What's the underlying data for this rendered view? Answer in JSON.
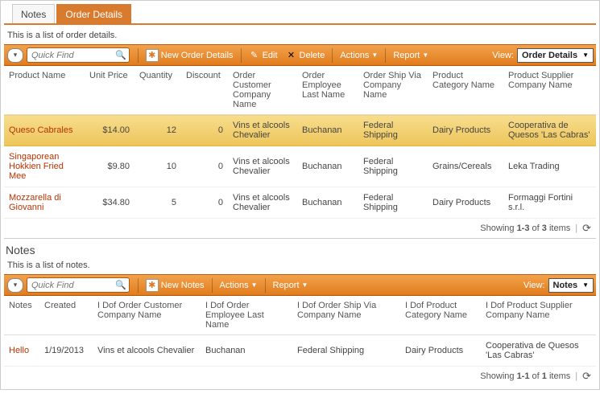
{
  "tabs": {
    "notes": "Notes",
    "order_details": "Order Details",
    "active": "order_details"
  },
  "od": {
    "subtitle": "This is a list of order details.",
    "search_placeholder": "Quick Find",
    "toolbar": {
      "new": "New Order Details",
      "edit": "Edit",
      "delete": "Delete",
      "actions": "Actions",
      "report": "Report",
      "view_label": "View:",
      "view_value": "Order Details"
    },
    "cols": [
      "Product Name",
      "Unit Price",
      "Quantity",
      "Discount",
      "Order Customer Company Name",
      "Order Employee Last Name",
      "Order Ship Via Company Name",
      "Product Category Name",
      "Product Supplier Company Name"
    ],
    "rows": [
      {
        "product": "Queso Cabrales",
        "price": "$14.00",
        "qty": "12",
        "disc": "0",
        "cust": "Vins et alcools Chevalier",
        "emp": "Buchanan",
        "ship": "Federal Shipping",
        "cat": "Dairy Products",
        "sup": "Cooperativa de Quesos 'Las Cabras'",
        "sel": true
      },
      {
        "product": "Singaporean Hokkien Fried Mee",
        "price": "$9.80",
        "qty": "10",
        "disc": "0",
        "cust": "Vins et alcools Chevalier",
        "emp": "Buchanan",
        "ship": "Federal Shipping",
        "cat": "Grains/Cereals",
        "sup": "Leka Trading"
      },
      {
        "product": "Mozzarella di Giovanni",
        "price": "$34.80",
        "qty": "5",
        "disc": "0",
        "cust": "Vins et alcools Chevalier",
        "emp": "Buchanan",
        "ship": "Federal Shipping",
        "cat": "Dairy Products",
        "sup": "Formaggi Fortini s.r.l."
      }
    ],
    "footer": {
      "prefix": "Showing ",
      "range": "1-3",
      "mid": " of ",
      "total": "3",
      "suffix": " items"
    }
  },
  "notes": {
    "title": "Notes",
    "subtitle": "This is a list of notes.",
    "search_placeholder": "Quick Find",
    "toolbar": {
      "new": "New Notes",
      "actions": "Actions",
      "report": "Report",
      "view_label": "View:",
      "view_value": "Notes"
    },
    "cols": [
      "Notes",
      "Created",
      "I Dof Order Customer Company Name",
      "I Dof Order Employee Last Name",
      "I Dof Order Ship Via Company Name",
      "I Dof Product Category Name",
      "I Dof Product Supplier Company Name"
    ],
    "rows": [
      {
        "note": "Hello",
        "created": "1/19/2013",
        "cust": "Vins et alcools Chevalier",
        "emp": "Buchanan",
        "ship": "Federal Shipping",
        "cat": "Dairy Products",
        "sup": "Cooperativa de Quesos 'Las Cabras'"
      }
    ],
    "footer": {
      "prefix": "Showing ",
      "range": "1-1",
      "mid": " of ",
      "total": "1",
      "suffix": " items"
    }
  }
}
